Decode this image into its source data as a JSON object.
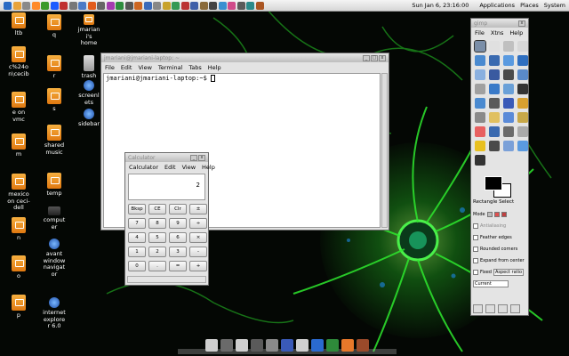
{
  "top_panel": {
    "clock": "Sun Jan 6, 23:16:00",
    "menus": [
      "Applications",
      "Places",
      "System"
    ],
    "launcher_colors": [
      "#2a6bc4",
      "#e8a33a",
      "#8a8a8a",
      "#ff8a2a",
      "#3a9a2a",
      "#1d5cff",
      "#c03030",
      "#777",
      "#4b7ac7",
      "#e25c1c",
      "#666",
      "#a43bb0",
      "#2d8d3d",
      "#555",
      "#cc6622",
      "#3a6abb",
      "#888",
      "#c8a22a",
      "#339955",
      "#bb3333",
      "#3f5fa8",
      "#8a6a3a",
      "#444",
      "#3a8fd0",
      "#d04a8a",
      "#5a5a5a",
      "#2a8a8a",
      "#aa5522"
    ]
  },
  "desktop": {
    "col1": [
      "ltb",
      "c%24on\\cecib",
      "e on vmc",
      "m",
      "mexico on ceci-dell",
      "n",
      "o",
      "p"
    ],
    "col2": [
      "q",
      "r",
      "s",
      "shared music",
      "temp",
      "computer",
      "avant window navigator",
      "internet explorer 6.0"
    ],
    "col3": [
      "jmariani's home",
      "trash",
      "screenlets",
      "sidebar"
    ]
  },
  "terminal": {
    "title": "jmariani@jmariani-laptop: ~",
    "menu": [
      "File",
      "Edit",
      "View",
      "Terminal",
      "Tabs",
      "Help"
    ],
    "prompt": "jmariani@jmariani-laptop:~$"
  },
  "calculator": {
    "title": "Calculator",
    "menu": [
      "Calculator",
      "Edit",
      "View",
      "Help"
    ],
    "display": "2",
    "buttons": [
      "Bksp",
      "CE",
      "Clr",
      "±",
      "7",
      "8",
      "9",
      "÷",
      "4",
      "5",
      "6",
      "×",
      "1",
      "2",
      "3",
      "-",
      "0",
      ".",
      "=",
      "+"
    ]
  },
  "gimp": {
    "title": "gimp",
    "menu": [
      "File",
      "Xtns",
      "Help"
    ],
    "tool_colors": [
      "#7a8ea8",
      "#e0e0e0",
      "#c0c0c0",
      "#d8d8d8",
      "#4a8ad0",
      "#3a6ab0",
      "#5a9ae0",
      "#2f6fc0",
      "#8ab0e0",
      "#3a5aa0",
      "#4a4a4a",
      "#5a8ac8",
      "#a0a0a0",
      "#3a7ac8",
      "#6aa0d8",
      "#333333",
      "#4a8ad0",
      "#5a5a5a",
      "#3a5ab8",
      "#d8a030",
      "#8a8a8a",
      "#e0c060",
      "#5a8ad8",
      "#c8a848",
      "#e86060",
      "#3a6ab0",
      "#6a6a6a",
      "#aaaaaa",
      "#e8c020",
      "#4a4a4a",
      "#7aa0d8",
      "#5a9ae0",
      "#333333"
    ],
    "options_title": "Rectangle Select",
    "mode_label": "Mode",
    "antialiasing": "Antialiasing",
    "feather": "Feather edges",
    "rounded": "Rounded corners",
    "expand": "Expand from center",
    "fixed": "Fixed",
    "aspect": "Aspect ratio",
    "current": "Current",
    "fg_color": "#000000",
    "bg_color": "#ffffff"
  },
  "dock": {
    "colors": [
      "#cfcfcf",
      "#6a6a6a",
      "#cfcfcf",
      "#5a5a5a",
      "#8a8a8a",
      "#3a5ab8",
      "#d0d0d0",
      "#2a6ad0",
      "#2e8a3a",
      "#e8782a",
      "#9a4a2a"
    ]
  }
}
